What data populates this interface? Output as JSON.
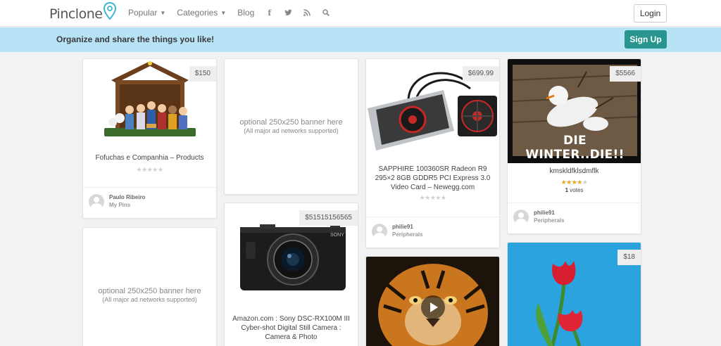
{
  "header": {
    "logo": "Pinclone",
    "nav": [
      {
        "label": "Popular",
        "dropdown": true
      },
      {
        "label": "Categories",
        "dropdown": true
      },
      {
        "label": "Blog",
        "dropdown": false
      }
    ],
    "social_icons": [
      "facebook-icon",
      "twitter-icon",
      "rss-icon",
      "search-icon"
    ],
    "login_label": "Login"
  },
  "banner": {
    "tagline": "Organize and share the things you like!",
    "signup_label": "Sign Up",
    "color": "#28958e"
  },
  "colors": {
    "banner_bg": "#b8e2f5",
    "star_on": "#e6a817",
    "star_off": "#cfcfcf"
  },
  "ad": {
    "line1": "optional 250x250 banner here",
    "line2": "(All major ad networks supported)"
  },
  "pins": {
    "nativity": {
      "price": "$150",
      "title": "Fofuchas e Companhia – Products",
      "rating": 0,
      "user": "Paulo Ribeiro",
      "board": "My Pins"
    },
    "camera": {
      "price": "$51515156565",
      "title": "Amazon.com : Sony DSC-RX100M III Cyber-shot Digital Still Camera : Camera & Photo",
      "rating": 0
    },
    "gpu": {
      "price": "$699.99",
      "title": "SAPPHIRE 100360SR Radeon R9 295×2 8GB GDDR5 PCI Express 3.0 Video Card – Newegg.com",
      "rating": 0,
      "user": "philie91",
      "board": "Peripherals"
    },
    "snowman": {
      "price": "$5566",
      "caption": "DIE WINTER..DIE!!",
      "title": "kmskldfklsdmflk",
      "rating": 4,
      "votes_count": "1",
      "votes_label": "votes",
      "user": "philie91",
      "board": "Peripherals"
    },
    "tulips": {
      "price": "$18"
    }
  }
}
